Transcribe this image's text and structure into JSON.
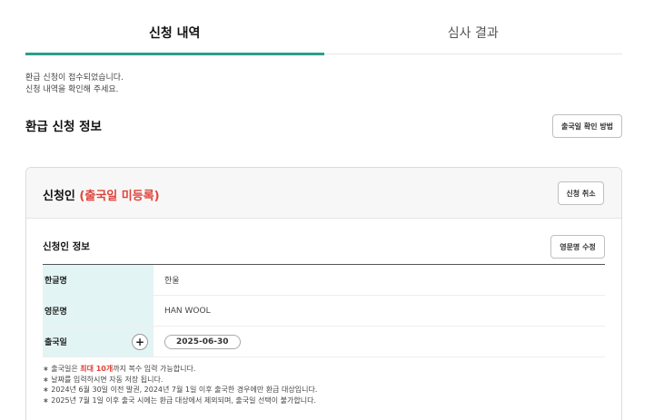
{
  "tabs": [
    {
      "label": "신청 내역"
    },
    {
      "label": "심사 결과"
    }
  ],
  "notice": {
    "line1": "환급 신청이 접수되었습니다.",
    "line2": "신청 내역을 확인해 주세요."
  },
  "section": {
    "title": "환급 신청 정보",
    "check_button": "출국일 확인 방법"
  },
  "card": {
    "title": "신청인",
    "status": "(출국일 미등록)",
    "cancel_button": "신청 취소",
    "subtitle": "신청인 정보",
    "edit_button": "영문명 수정",
    "rows": [
      {
        "label": "한글명",
        "value": "한울"
      },
      {
        "label": "영문명",
        "value": "HAN WOOL"
      },
      {
        "label": "출국일",
        "value": "2025-06-30",
        "add": "+"
      }
    ],
    "notes": {
      "n1_pre": "∗ 출국일은 ",
      "n1_hl": "최대 10개",
      "n1_post": "까지 복수 입력 가능합니다.",
      "n2": "∗ 날짜를 입력하시면 자동 저장 됩니다.",
      "n3": "∗ 2024년 6월 30일 이전 발권, 2024년 7월 1일 이후 출국한 경우에만 환급 대상입니다.",
      "n4": "∗ 2025년 7월 1일 이후 출국 시에는 환급 대상에서 제외되며, 출국일 선택이 불가합니다."
    }
  },
  "colors": {
    "accent": "#2a9d8f",
    "status": "#e0433a",
    "table_header_bg": "#e3f4f5"
  }
}
